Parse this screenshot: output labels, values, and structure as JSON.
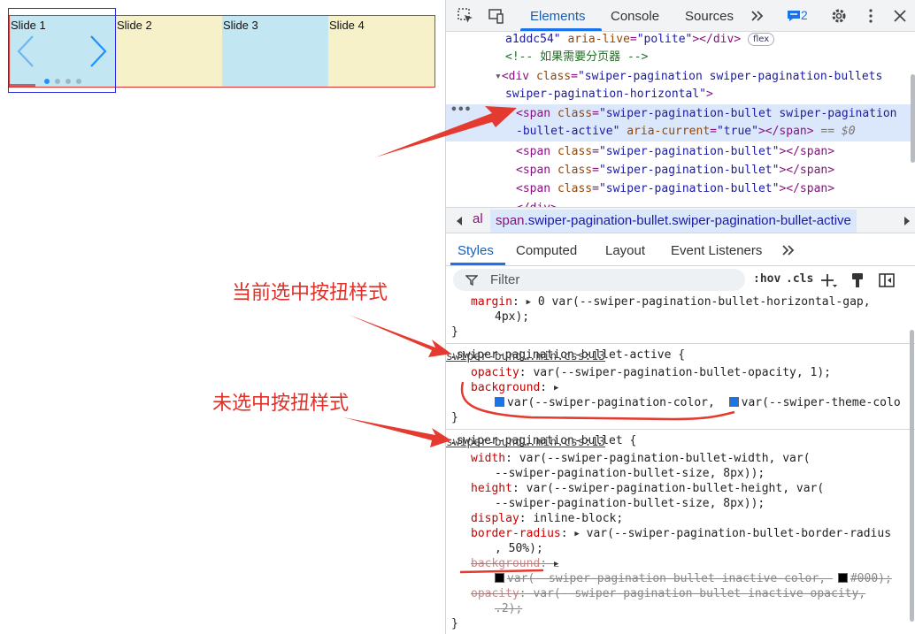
{
  "swiper": {
    "slides": [
      {
        "label": "Slide 1"
      },
      {
        "label": "Slide 2"
      },
      {
        "label": "Slide 3"
      },
      {
        "label": "Slide 4"
      }
    ],
    "active_index": 0,
    "bullet_count": 4,
    "bullet_active_color": "#1e90ff",
    "arrow_color": "#1e90ff"
  },
  "annotations": {
    "active_style": "当前选中按扭样式",
    "inactive_style": "未选中按扭样式"
  },
  "devtools": {
    "tabs": [
      "Elements",
      "Console",
      "Sources"
    ],
    "active_tab": "Elements",
    "issues_count": "2",
    "dom": {
      "line1": {
        "text": "a1ddc54\"",
        "attr": "aria-live",
        "val": "\"polite\"",
        "close": "></div>",
        "pill": "flex"
      },
      "comment": "<!-- 如果需要分页器 -->",
      "div_open": {
        "tag": "<div",
        "attr": "class",
        "val": "\"swiper-pagination swiper-pagination-bullets",
        "val2": "swiper-pagination-horizontal\"",
        "end": ">"
      },
      "selected_span": {
        "line1_tag": "<span",
        "attr": "class",
        "val1": "\"swiper-pagination-bullet swiper-pagination",
        "val2": "-bullet-active\"",
        "attr2": "aria-current",
        "val3": "\"true\"",
        "close": "></span>",
        "marker": "== $0"
      },
      "bullet_span": "<span class=\"swiper-pagination-bullet\"></span>",
      "bullet_attr": "class",
      "bullet_val": "\"swiper-pagination-bullet\"",
      "div_close": "</div>"
    },
    "breadcrumb": {
      "prev": "al",
      "tag": "span",
      "classes": ".swiper-pagination-bullet.swiper-pagination-bullet-active"
    },
    "subtabs": [
      "Styles",
      "Computed",
      "Layout",
      "Event Listeners"
    ],
    "active_subtab": "Styles",
    "filter_placeholder": "Filter",
    "filter_tools": [
      ":hov",
      ".cls"
    ],
    "styles": {
      "margin_prop": "margin",
      "margin_val": "0 var(--swiper-pagination-bullet-horizontal-gap,",
      "margin_val2": "4px);",
      "rule1": {
        "selector": ".swiper-pagination-bullet-active {",
        "source": "swiper-bund….min.css:13",
        "opacity_prop": "opacity",
        "opacity_val": "var(--swiper-pagination-bullet-opacity, 1);",
        "bg_prop": "background",
        "bg_val1": "var(--swiper-pagination-color,",
        "bg_val2": "var(--swiper-theme-colo",
        "swatch_color": "#1a73e8"
      },
      "rule2": {
        "selector": ".swiper-pagination-bullet {",
        "source": "swiper-bund….min.css:13",
        "width_prop": "width",
        "width_val": "var(--swiper-pagination-bullet-width, var(",
        "width_val2": "--swiper-pagination-bullet-size, 8px));",
        "height_prop": "height",
        "height_val": "var(--swiper-pagination-bullet-height, var(",
        "height_val2": "--swiper-pagination-bullet-size, 8px));",
        "display_prop": "display",
        "display_val": "inline-block;",
        "radius_prop": "border-radius",
        "radius_val": "var(--swiper-pagination-bullet-border-radius",
        "radius_val2": ", 50%);",
        "bg_prop": "background",
        "bg_val": "var(--swiper-pagination-bullet-inactive-color,",
        "bg_hex": "#000);",
        "opacity_prop": "opacity",
        "opacity_val": "var(--swiper-pagination-bullet-inactive-opacity,",
        "opacity_val2": ".2);",
        "swatch_color": "#000000"
      }
    }
  }
}
